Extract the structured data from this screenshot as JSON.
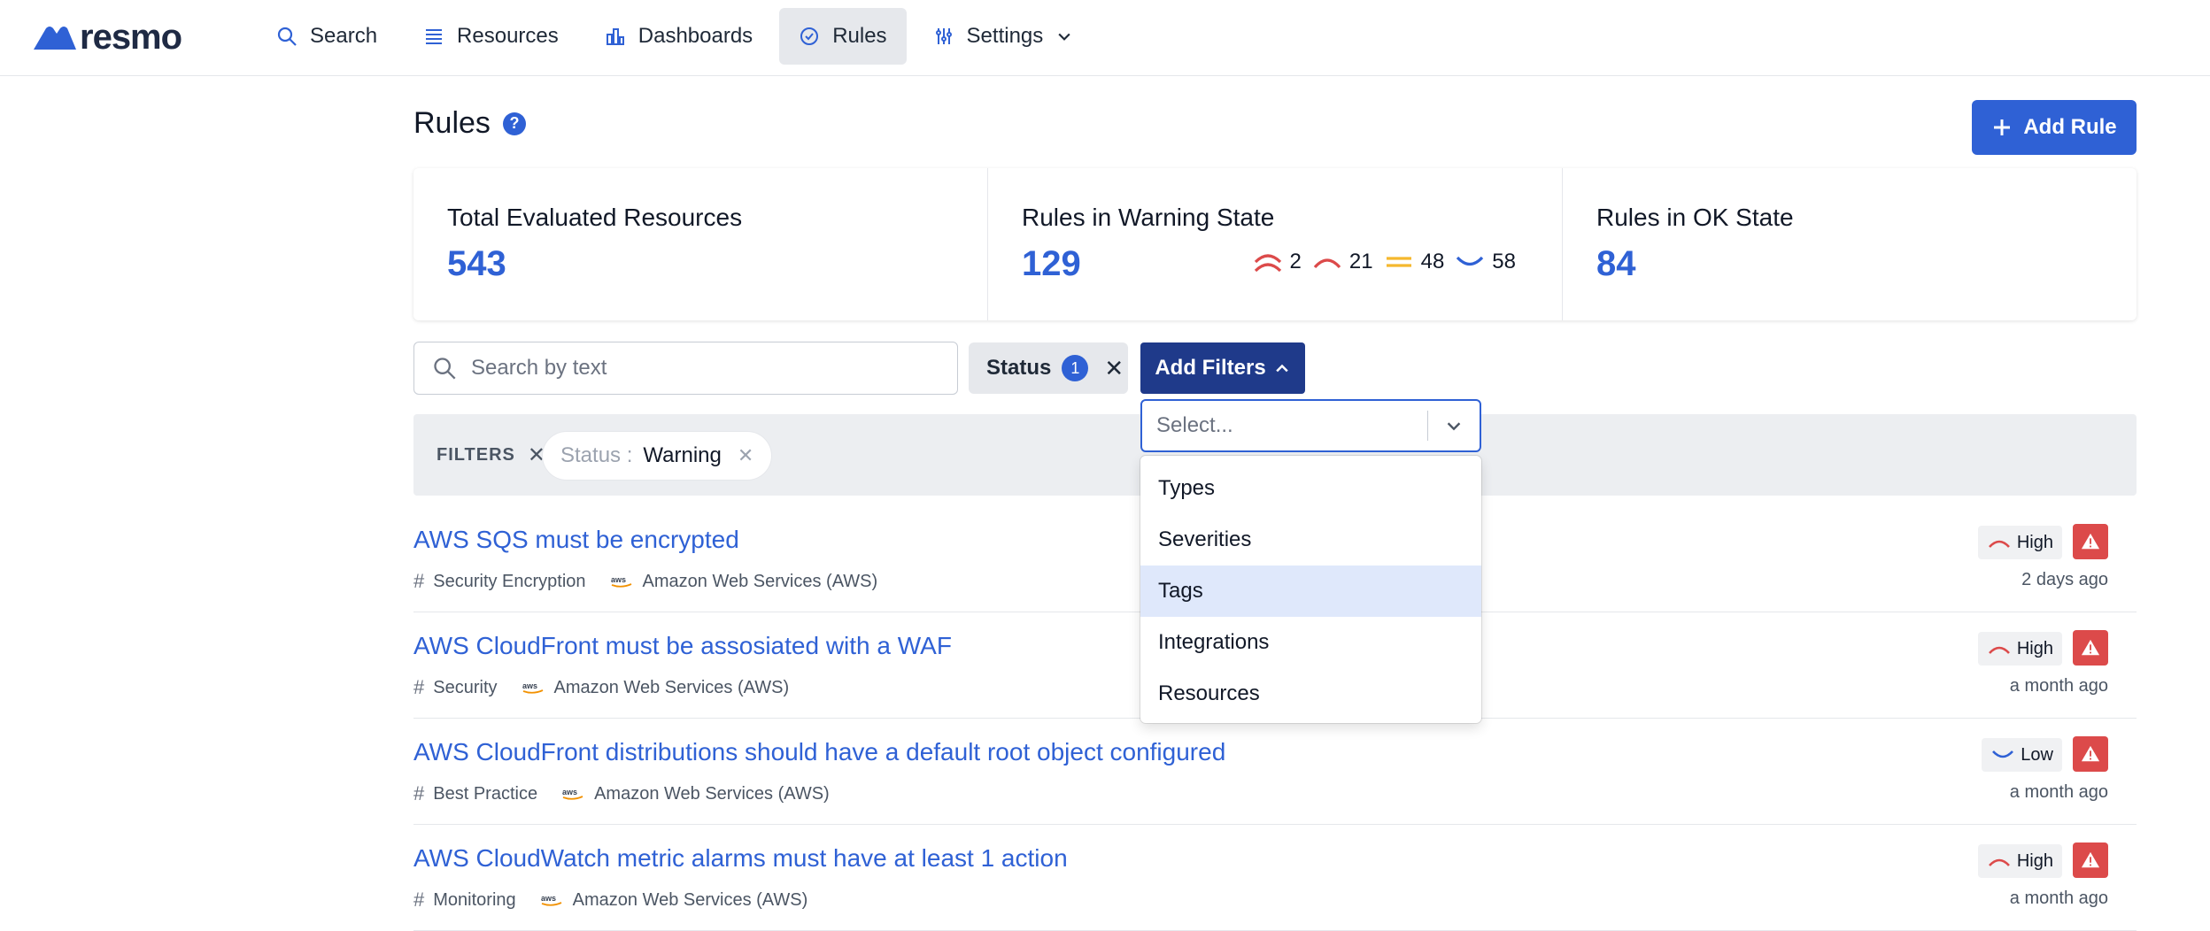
{
  "app": {
    "logo_text": "resmo"
  },
  "nav": {
    "items": [
      {
        "label": "Search",
        "icon": "search-icon"
      },
      {
        "label": "Resources",
        "icon": "list-icon"
      },
      {
        "label": "Dashboards",
        "icon": "bar-chart-icon"
      },
      {
        "label": "Rules",
        "icon": "check-circle-icon",
        "active": true
      },
      {
        "label": "Settings",
        "icon": "sliders-icon"
      }
    ]
  },
  "header": {
    "title": "Rules",
    "help_glyph": "?",
    "add_rule_label": "Add Rule"
  },
  "stats": {
    "total": {
      "label": "Total Evaluated Resources",
      "value": "543"
    },
    "warning": {
      "label": "Rules in Warning State",
      "value": "129",
      "severity_counts": {
        "critical": "2",
        "high": "21",
        "medium": "48",
        "low": "58"
      }
    },
    "ok": {
      "label": "Rules in OK State",
      "value": "84"
    }
  },
  "toolbar": {
    "search_placeholder": "Search by text",
    "status_chip_label": "Status",
    "status_chip_count": "1",
    "add_filters_label": "Add Filters"
  },
  "filters": {
    "label": "FILTERS",
    "pill_key": "Status :",
    "pill_value": "Warning"
  },
  "dropdown": {
    "placeholder": "Select...",
    "options": [
      "Types",
      "Severities",
      "Tags",
      "Integrations",
      "Resources"
    ],
    "focused_index": 2
  },
  "rules": [
    {
      "title": "AWS SQS must be encrypted",
      "tags": "Security Encryption",
      "integration": "Amazon Web Services (AWS)",
      "severity": "High",
      "time": "2 days ago"
    },
    {
      "title": "AWS CloudFront must be assosiated with a WAF",
      "tags": "Security",
      "integration": "Amazon Web Services (AWS)",
      "severity": "High",
      "time": "a month ago"
    },
    {
      "title": "AWS CloudFront distributions should have a default root object configured",
      "tags": "Best Practice",
      "integration": "Amazon Web Services (AWS)",
      "severity": "Low",
      "time": "a month ago"
    },
    {
      "title": "AWS CloudWatch metric alarms must have at least 1 action",
      "tags": "Monitoring",
      "integration": "Amazon Web Services (AWS)",
      "severity": "High",
      "time": "a month ago"
    }
  ],
  "colors": {
    "accent": "#2f61d5",
    "accent_dark": "#1f3a8a",
    "danger": "#dc4a4a",
    "medium": "#f5b82e",
    "aws_orange": "#f29100"
  }
}
